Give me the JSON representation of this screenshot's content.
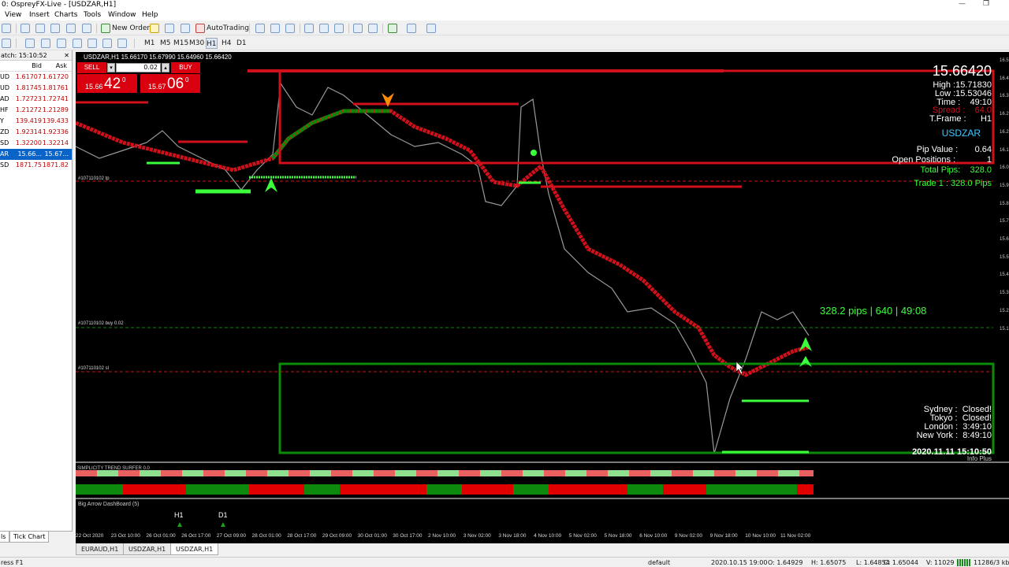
{
  "window": {
    "title": "0: OspreyFX-Live - [USDZAR,H1]",
    "min": "—",
    "restore": "❐"
  },
  "menu": [
    "View",
    "Insert",
    "Charts",
    "Tools",
    "Window",
    "Help"
  ],
  "toolbar": {
    "new_order": "New Order",
    "autotrading": "AutoTrading"
  },
  "timeframes": [
    "M1",
    "M5",
    "M15",
    "M30",
    "H1",
    "H4",
    "D1"
  ],
  "market_watch": {
    "header": "atch: 15:10:52",
    "col_bid": "Bid",
    "col_ask": "Ask",
    "rows": [
      {
        "symbol": "UD",
        "bid": "1.61707",
        "ask": "1.61720"
      },
      {
        "symbol": "UD",
        "bid": "1.81745",
        "ask": "1.81761"
      },
      {
        "symbol": "AD",
        "bid": "1.72723",
        "ask": "1.72741"
      },
      {
        "symbol": "HF",
        "bid": "1.21272",
        "ask": "1.21289"
      },
      {
        "symbol": "Y",
        "bid": "139.419",
        "ask": "139.433"
      },
      {
        "symbol": "ZD",
        "bid": "1.92314",
        "ask": "1.92336"
      },
      {
        "symbol": "SD",
        "bid": "1.32200",
        "ask": "1.32214"
      },
      {
        "symbol": "AR",
        "bid": "15.66...",
        "ask": "15.67..."
      },
      {
        "symbol": "SD",
        "bid": "1871.75",
        "ask": "1871.82"
      }
    ],
    "tab_symbols": "ls",
    "tab_tick": "Tick Chart"
  },
  "chart": {
    "header": "USDZAR,H1  15.66170 15.67990 15.64960 15.66420",
    "sell_label": "SELL",
    "buy_label": "BUY",
    "lot": "0.02",
    "sell_price_small": "15.66",
    "sell_price_big": "42",
    "sell_sup": "0",
    "buy_price_small": "15.67",
    "buy_price_big": "06",
    "buy_sup": "0",
    "price_big": "15.66420",
    "high": "High :15.71830",
    "low": "Low :15.53046",
    "time": "Time :",
    "time_val": "49:10",
    "spread": "Spread :",
    "spread_val": "64.0",
    "tframe": "T.Frame :",
    "tframe_val": "H1",
    "symbol": "USDZAR",
    "pip_value_label": "Pip Value :",
    "pip_value": "0.64",
    "open_positions_label": "Open Positions :",
    "open_positions": "1",
    "total_pips_label": "Total Pips:",
    "total_pips": "328.0",
    "trade_line": "Trade 1 : 328.0 Pips",
    "pips_overlay": "328.2 pips | 640 | 49:08",
    "order_tp": "#107110102 tp",
    "order_buy": "#107110102 buy 0.02",
    "order_sl": "#107110102 sl",
    "sessions": [
      {
        "name": "Sydney :",
        "status": "Closed!"
      },
      {
        "name": "Tokyo :",
        "status": "Closed!"
      },
      {
        "name": "London :",
        "status": "3:49:10"
      },
      {
        "name": "New York :",
        "status": "8:49:10"
      }
    ],
    "datetime": "2020.11.11 15:10:50",
    "info_plus": "Info Plus",
    "indicator1": "SIMPLICITY TREND SURFER 0.0",
    "indicator2": "Big Arrow DashBoard (5)",
    "dash_h1": "H1",
    "dash_d1": "D1",
    "price_axis": [
      "16.5",
      "16.4",
      "16.3",
      "16.2",
      "16.2",
      "16.1",
      "16.0",
      "15.9",
      "15.8",
      "15.7",
      "15.6",
      "15.5",
      "15.4",
      "15.3",
      "15.2",
      "15.1"
    ],
    "time_axis": [
      "22 Oct 2020",
      "23 Oct 10:00",
      "26 Oct 01:00",
      "26 Oct 17:00",
      "27 Oct 09:00",
      "28 Oct 01:00",
      "28 Oct 17:00",
      "29 Oct 09:00",
      "30 Oct 01:00",
      "30 Oct 17:00",
      "2 Nov 10:00",
      "3 Nov 02:00",
      "3 Nov 18:00",
      "4 Nov 10:00",
      "5 Nov 02:00",
      "5 Nov 18:00",
      "6 Nov 10:00",
      "9 Nov 02:00",
      "9 Nov 18:00",
      "10 Nov 10:00",
      "11 Nov 02:00"
    ]
  },
  "chart_tabs": [
    "EURAUD,H1",
    "USDZAR,H1",
    "USDZAR,H1"
  ],
  "status": {
    "left": "ress F1",
    "profile": "default",
    "datetime": "2020.10.15 19:00",
    "open": "O: 1.64929",
    "high": "H: 1.65075",
    "low": "L: 1.64854",
    "close": "C: 1.65044",
    "volume": "V: 11029",
    "traffic": "11286/3 kb"
  },
  "colors": {
    "red": "#d0101a",
    "green": "#0a8c0a",
    "lime": "#3cff3c",
    "chart_bg": "#000000"
  }
}
